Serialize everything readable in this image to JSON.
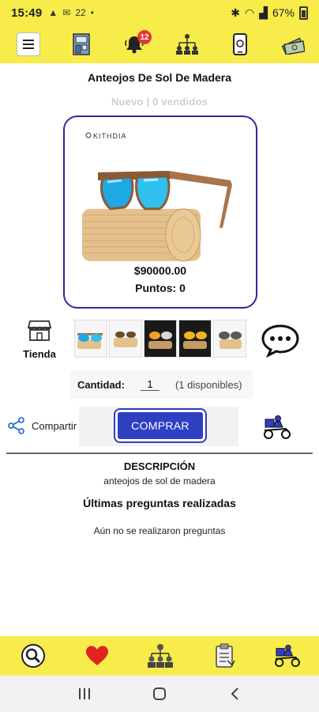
{
  "status_bar": {
    "time": "15:49",
    "notif_count": "22",
    "battery": "67%"
  },
  "top_nav": {
    "notification_badge": "12",
    "icons": [
      "menu-icon",
      "store-front-icon",
      "bell-icon",
      "network-tree-icon",
      "phone-icon",
      "money-icon"
    ]
  },
  "product": {
    "title": "Anteojos De Sol De Madera",
    "condition": "Nuevo | 0 vendidos",
    "brand_text": "KITHDIA",
    "price": "$90000.00",
    "points": "Puntos: 0"
  },
  "store": {
    "label": "Tienda"
  },
  "quantity": {
    "label": "Cantidad:",
    "value": "1",
    "available": "(1 disponibles)"
  },
  "actions": {
    "share_label": "Compartir",
    "buy_label": "COMPRAR"
  },
  "description": {
    "title": "DESCRIPCIÓN",
    "text": "anteojos de sol  de madera"
  },
  "questions": {
    "title": "Últimas preguntas realizadas",
    "empty": "Aún no se realizaron preguntas"
  },
  "bottom_nav": {
    "icons": [
      "search-icon",
      "heart-icon",
      "network-icon",
      "clipboard-icon",
      "delivery-icon"
    ]
  },
  "colors": {
    "bar_yellow": "#f7ec4a",
    "accent_blue": "#2e3fc2",
    "card_border": "#2c2aa3"
  }
}
